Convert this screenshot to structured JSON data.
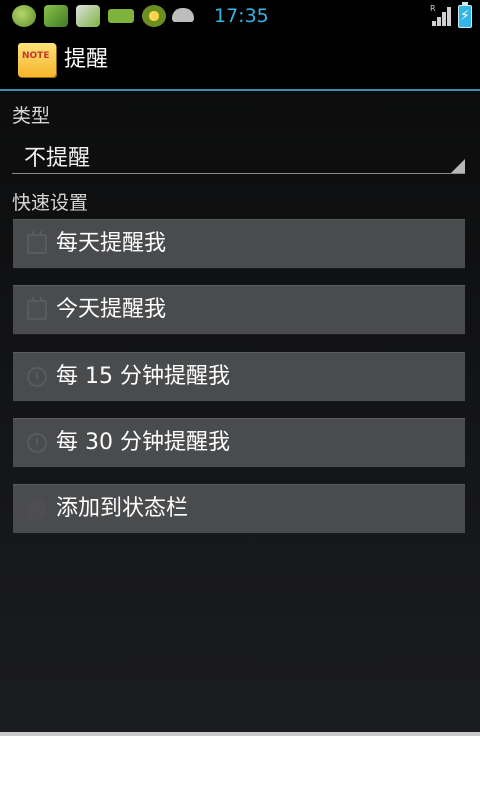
{
  "status_bar": {
    "time": "17:35",
    "time_color": "#33b5e5",
    "signal_label": "R"
  },
  "action_bar": {
    "app_icon_text": "NOTE",
    "title": "提醒"
  },
  "type_section": {
    "label": "类型",
    "spinner_value": "不提醒"
  },
  "quick_section": {
    "label": "快速设置",
    "buttons": [
      {
        "label": "每天提醒我",
        "icon": "calendar-icon"
      },
      {
        "label": "今天提醒我",
        "icon": "calendar-icon"
      },
      {
        "label": "每 15 分钟提醒我",
        "icon": "clock-icon"
      },
      {
        "label": "每 30 分钟提醒我",
        "icon": "clock-icon"
      },
      {
        "label": "添加到状态栏",
        "icon": "pin-icon"
      }
    ]
  },
  "colors": {
    "accent": "#33b5e5",
    "action_bar_divider": "#3a8dad",
    "button_bg": "#4a4b4d"
  }
}
